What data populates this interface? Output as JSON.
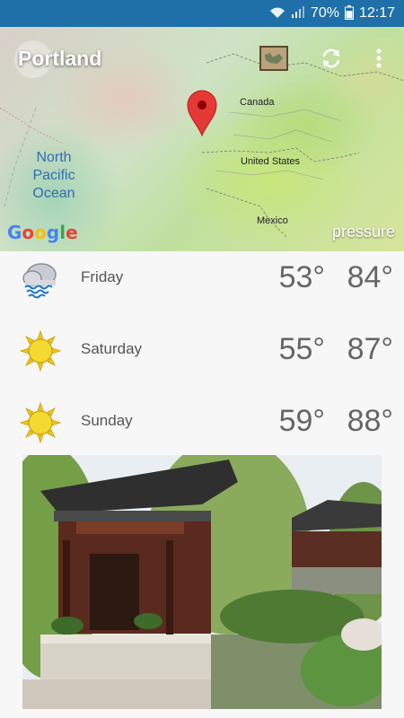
{
  "status_bar": {
    "battery": "70%",
    "time": "12:17"
  },
  "map": {
    "title": "Portland",
    "labels": {
      "canada": "Canada",
      "united_states": "United States",
      "mexico": "Mexico",
      "ocean": "North Pacific Ocean"
    },
    "google": "Google",
    "overlay": "pressure"
  },
  "forecast": [
    {
      "day": "Friday",
      "low": "53°",
      "high": "84°",
      "icon": "rain-cloud-icon"
    },
    {
      "day": "Saturday",
      "low": "55°",
      "high": "87°",
      "icon": "sun-icon"
    },
    {
      "day": "Sunday",
      "low": "59°",
      "high": "88°",
      "icon": "sun-icon"
    }
  ]
}
